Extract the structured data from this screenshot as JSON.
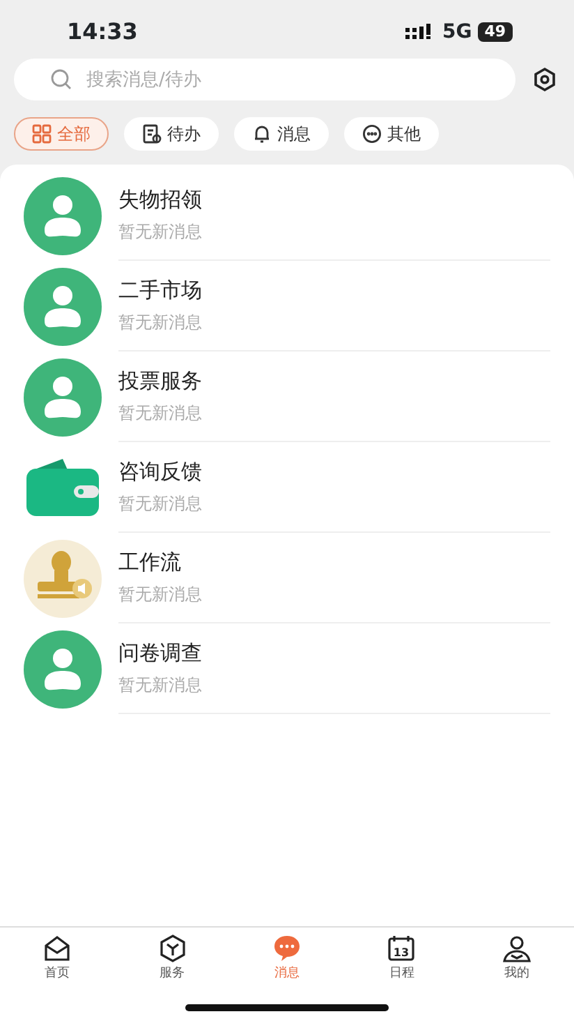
{
  "status_bar": {
    "time": "14:33",
    "network": "5G",
    "battery": "49"
  },
  "search": {
    "placeholder": "搜索消息/待办"
  },
  "filters": [
    {
      "label": "全部",
      "kind": "grid",
      "selected": true
    },
    {
      "label": "待办",
      "kind": "todo",
      "selected": false
    },
    {
      "label": "消息",
      "kind": "bell",
      "selected": false
    },
    {
      "label": "其他",
      "kind": "more",
      "selected": false
    }
  ],
  "messages": [
    {
      "title": "失物招领",
      "preview": "暂无新消息",
      "kind": "person"
    },
    {
      "title": "二手市场",
      "preview": "暂无新消息",
      "kind": "person"
    },
    {
      "title": "投票服务",
      "preview": "暂无新消息",
      "kind": "person"
    },
    {
      "title": "咨询反馈",
      "preview": "暂无新消息",
      "kind": "wallet"
    },
    {
      "title": "工作流",
      "preview": "暂无新消息",
      "kind": "stamp"
    },
    {
      "title": "问卷调查",
      "preview": "暂无新消息",
      "kind": "person"
    }
  ],
  "tab_bar": [
    {
      "label": "首页",
      "kind": "home",
      "selected": false
    },
    {
      "label": "服务",
      "kind": "box",
      "selected": false
    },
    {
      "label": "消息",
      "kind": "chat",
      "selected": true
    },
    {
      "label": "日程",
      "kind": "calendar",
      "day": "13",
      "selected": false
    },
    {
      "label": "我的",
      "kind": "user",
      "selected": false
    }
  ]
}
